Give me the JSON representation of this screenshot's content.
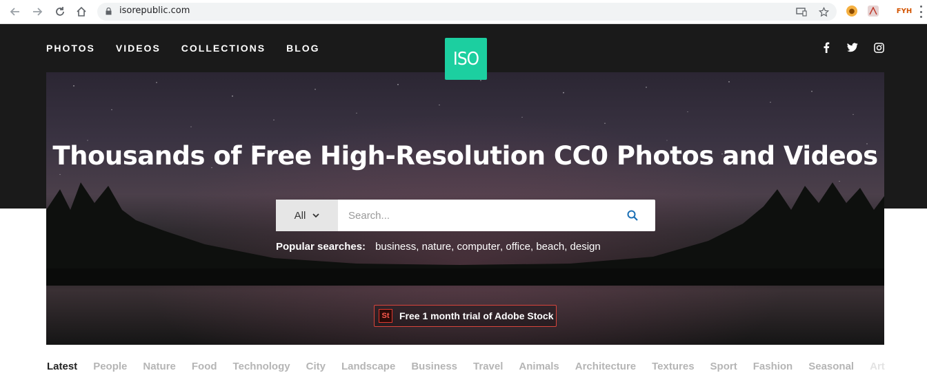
{
  "browser": {
    "url": "isorepublic.com",
    "icons": [
      "back-arrow-icon",
      "forward-arrow-icon",
      "reload-icon",
      "home-icon",
      "lock-icon",
      "cast-icon",
      "bookmark-star-icon",
      "cookie-extension-icon",
      "pdf-extension-icon",
      "fyh-extension-icon",
      "menu-icon"
    ]
  },
  "site": {
    "nav": [
      "PHOTOS",
      "VIDEOS",
      "COLLECTIONS",
      "BLOG"
    ],
    "logo_text": "ISO",
    "social": [
      "facebook-icon",
      "twitter-icon",
      "instagram-icon"
    ],
    "brand_color": "#1ccfa0"
  },
  "hero": {
    "title": "Thousands of Free High-Resolution CC0 Photos and Videos",
    "search": {
      "selected_type": "All",
      "placeholder": "Search...",
      "value": ""
    },
    "popular_label": "Popular searches:",
    "popular_terms": [
      "business",
      "nature",
      "computer",
      "office",
      "beach",
      "design"
    ],
    "promo": {
      "badge": "St",
      "text": "Free 1 month trial of Adobe Stock"
    }
  },
  "categories": {
    "active": "Latest",
    "items": [
      "Latest",
      "People",
      "Nature",
      "Food",
      "Technology",
      "City",
      "Landscape",
      "Business",
      "Travel",
      "Animals",
      "Architecture",
      "Textures",
      "Sport",
      "Fashion",
      "Seasonal",
      "Art"
    ]
  }
}
